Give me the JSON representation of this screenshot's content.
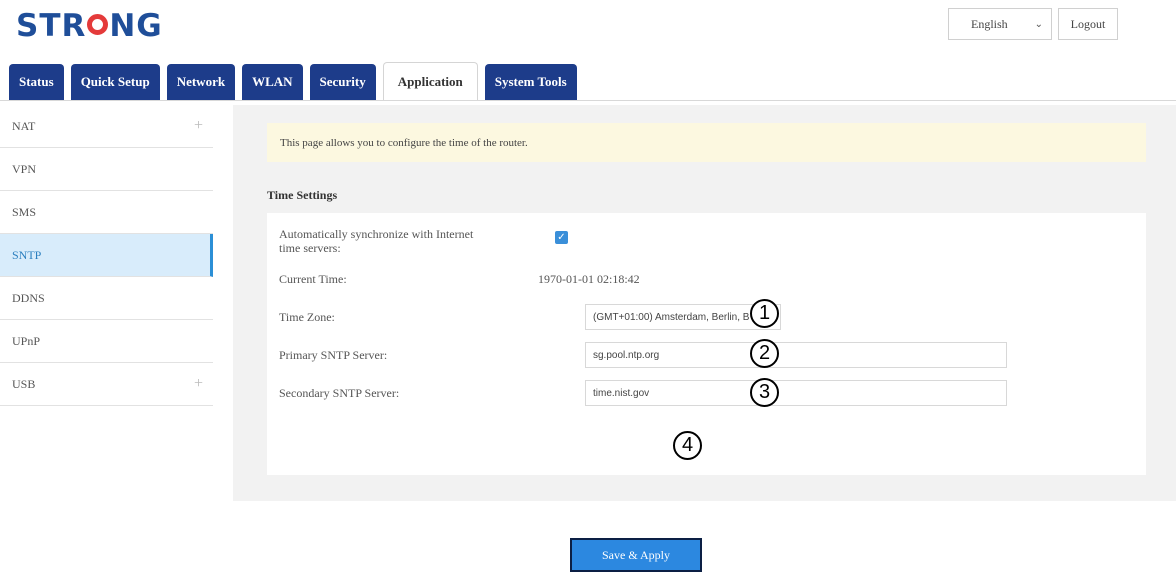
{
  "brand": {
    "logo": "STRONG",
    "logo_parts": [
      "STR",
      "NG"
    ]
  },
  "header": {
    "language": "English",
    "logout_label": "Logout"
  },
  "tabs": [
    {
      "label": "Status",
      "active": false
    },
    {
      "label": "Quick Setup",
      "active": false
    },
    {
      "label": "Network",
      "active": false
    },
    {
      "label": "WLAN",
      "active": false
    },
    {
      "label": "Security",
      "active": false
    },
    {
      "label": "Application",
      "active": true
    },
    {
      "label": "System Tools",
      "active": false
    }
  ],
  "sidebar": {
    "items": [
      {
        "label": "NAT",
        "expandable": true
      },
      {
        "label": "VPN",
        "expandable": false
      },
      {
        "label": "SMS",
        "expandable": false
      },
      {
        "label": "SNTP",
        "expandable": false,
        "active": true
      },
      {
        "label": "DDNS",
        "expandable": false
      },
      {
        "label": "UPnP",
        "expandable": false
      },
      {
        "label": "USB",
        "expandable": true
      }
    ],
    "plus_glyph": "+"
  },
  "main": {
    "notice": "This page allows you to configure the time of the router.",
    "section_title": "Time Settings",
    "auto_sync_label": "Automatically synchronize with Internet time servers:",
    "auto_sync_checked": true,
    "current_time_label": "Current Time:",
    "current_time_value": "1970-01-01 02:18:42",
    "time_zone_label": "Time Zone:",
    "time_zone_value": "(GMT+01:00) Amsterdam, Berlin, B",
    "primary_label": "Primary SNTP Server:",
    "primary_value": "sg.pool.ntp.org",
    "secondary_label": "Secondary SNTP Server:",
    "secondary_value": "time.nist.gov",
    "save_label": "Save & Apply"
  },
  "callouts": [
    "1",
    "2",
    "3",
    "4"
  ],
  "colors": {
    "tab_bg": "#1d3c8a",
    "accent": "#2c88e0",
    "notice_bg": "#fcf8e0",
    "active_side": "#d8ecfb"
  }
}
